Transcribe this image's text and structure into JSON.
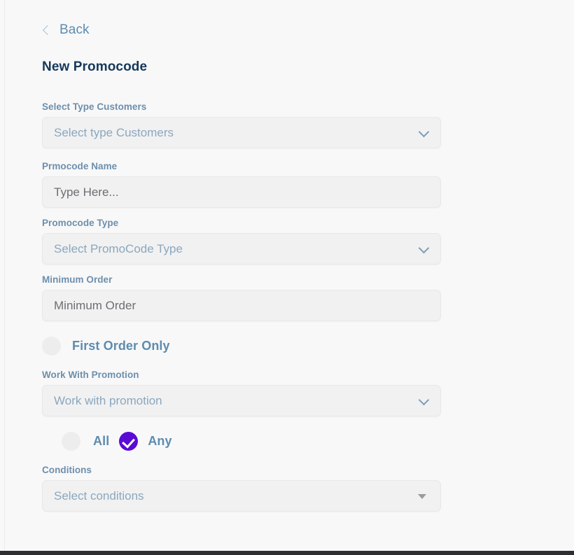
{
  "nav": {
    "back_label": "Back",
    "back_icon": "chevron-left-icon"
  },
  "header": {
    "title": "New Promocode"
  },
  "form": {
    "fields": [
      {
        "label": "Select Type Customers",
        "placeholder": "Select type Customers",
        "type": "select",
        "icon": "chevron-down-icon"
      },
      {
        "label": "Prmocode Name",
        "placeholder": "Type Here...",
        "type": "text"
      },
      {
        "label": "Promocode Type",
        "placeholder": "Select PromoCode Type",
        "type": "select",
        "icon": "chevron-down-icon"
      },
      {
        "label": "Minimum Order",
        "placeholder": "Minimum Order",
        "type": "text"
      },
      {
        "label": "Work With Promotion",
        "placeholder": "Work with promotion",
        "type": "select",
        "icon": "chevron-down-icon"
      },
      {
        "label": "Conditions",
        "placeholder": "Select conditions",
        "type": "select",
        "icon": "triangle-down-icon"
      }
    ],
    "first_order_only": {
      "label": "First Order Only",
      "checked": false
    },
    "match_mode": {
      "all_label": "All",
      "all_checked": false,
      "any_label": "Any",
      "any_checked": true
    }
  },
  "colors": {
    "accent_purple": "#5a0bd4",
    "label_blue": "#6d8fab",
    "title_navy": "#17385a",
    "page_background": "#f8f8f9",
    "field_fill": "#f1f1f2",
    "bottom_bar": "#2e2e32"
  }
}
